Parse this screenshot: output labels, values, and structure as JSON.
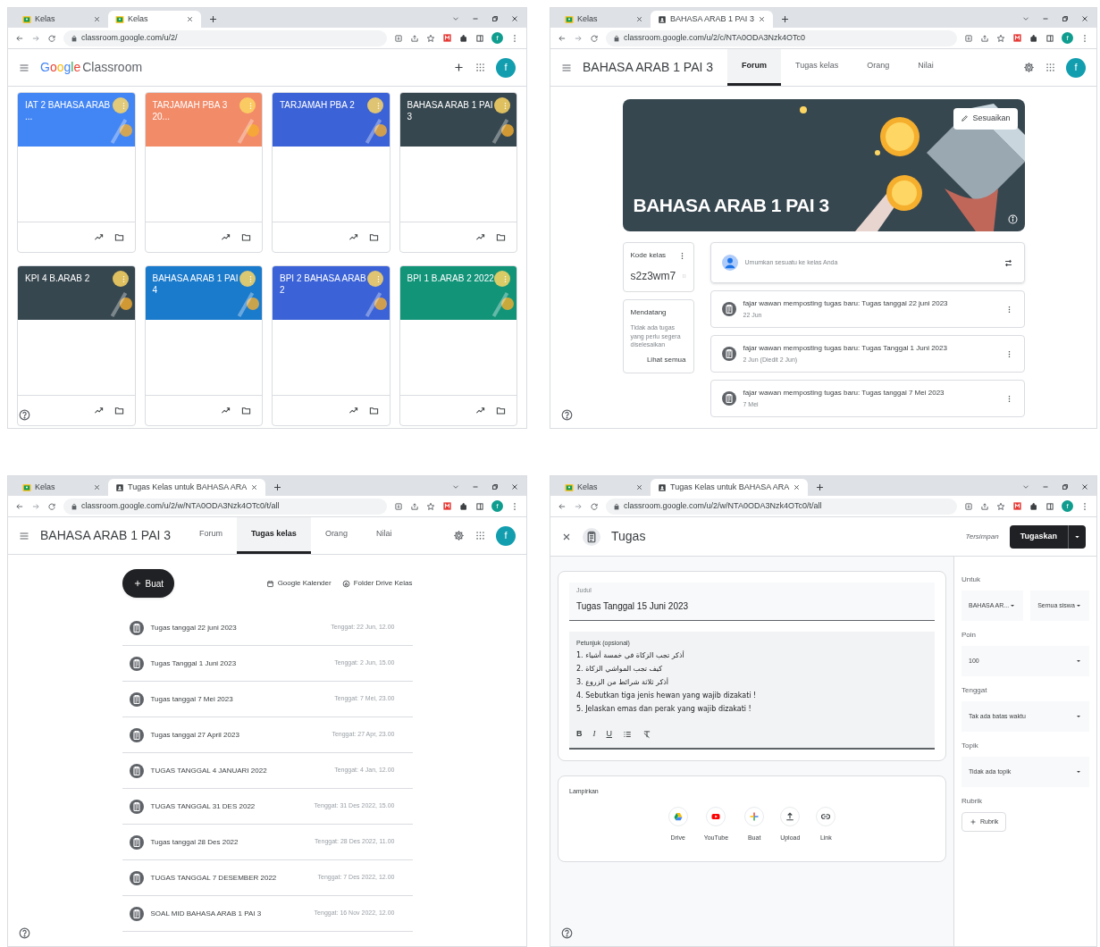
{
  "windows": [
    {
      "kind": "class_list",
      "tabs": [
        {
          "title": "Kelas",
          "kind": "classroom",
          "selected": false
        },
        {
          "title": "Kelas",
          "kind": "classroom",
          "selected": true
        }
      ],
      "url": "classroom.google.com/u/2/",
      "profile": "f",
      "logo_brand": "Google",
      "logo_product": "Classroom",
      "avatar": "f",
      "classes": [
        {
          "name": "IAT 2 BAHASA ARAB ...",
          "color": "#4285f4"
        },
        {
          "name": "TARJAMAH PBA 3 20...",
          "color": "#f28b68"
        },
        {
          "name": "TARJAMAH PBA 2",
          "color": "#3b62d6"
        },
        {
          "name": "BAHASA ARAB 1 PAI 3",
          "color": "#37474f"
        },
        {
          "name": "KPI 4 B.ARAB 2",
          "color": "#37474f"
        },
        {
          "name": "BAHASA ARAB 1 PAI 4",
          "color": "#1a7acc"
        },
        {
          "name": "BPI 2 BAHASA ARAB 2",
          "color": "#3b62d6"
        },
        {
          "name": "BPI 1 B.ARAB 2 2022",
          "color": "#129479"
        }
      ]
    },
    {
      "kind": "class_stream",
      "tabs": [
        {
          "title": "Kelas",
          "kind": "classroom",
          "selected": false
        },
        {
          "title": "BAHASA ARAB 1 PAI 3",
          "kind": "class",
          "selected": true
        }
      ],
      "url": "classroom.google.com/u/2/c/NTA0ODA3Nzk4OTc0",
      "profile": "f",
      "title": "BAHASA ARAB 1 PAI 3",
      "nav": [
        {
          "label": "Forum",
          "selected": true
        },
        {
          "label": "Tugas kelas",
          "selected": false
        },
        {
          "label": "Orang",
          "selected": false
        },
        {
          "label": "Nilai",
          "selected": false
        }
      ],
      "avatar": "f",
      "banner_title": "BAHASA ARAB 1 PAI 3",
      "customize": "Sesuaikan",
      "code_label": "Kode kelas",
      "code": "s2z3wm7",
      "upcoming_title": "Mendatang",
      "upcoming_text": "Tidak ada tugas yang perlu segera diselesaikan",
      "upcoming_link": "Lihat semua",
      "announce": "Umumkan sesuatu ke kelas Anda",
      "posts": [
        {
          "text": "fajar wawan memposting tugas baru: Tugas tanggal 22 juni 2023",
          "date": "22 Jun"
        },
        {
          "text": "fajar wawan memposting tugas baru: Tugas Tanggal 1 Juni 2023",
          "date": "2 Jun (Diedit 2 Jun)"
        },
        {
          "text": "fajar wawan memposting tugas baru: Tugas tanggal 7 Mei 2023",
          "date": "7 Mei"
        }
      ]
    },
    {
      "kind": "classwork",
      "tabs": [
        {
          "title": "Kelas",
          "kind": "classroom",
          "selected": false
        },
        {
          "title": "Tugas Kelas untuk BAHASA ARA",
          "kind": "class",
          "selected": true
        }
      ],
      "url": "classroom.google.com/u/2/w/NTA0ODA3Nzk4OTc0/t/all",
      "profile": "f",
      "title": "BAHASA ARAB 1 PAI 3",
      "nav": [
        {
          "label": "Forum",
          "selected": false
        },
        {
          "label": "Tugas kelas",
          "selected": true
        },
        {
          "label": "Orang",
          "selected": false
        },
        {
          "label": "Nilai",
          "selected": false
        }
      ],
      "avatar": "f",
      "create": "Buat",
      "calendar": "Google Kalender",
      "drive_folder": "Folder Drive Kelas",
      "assignments": [
        {
          "title": "Tugas tanggal 22 juni 2023",
          "due": "Tenggat: 22 Jun, 12.00"
        },
        {
          "title": "Tugas Tanggal 1 Juni 2023",
          "due": "Tenggat: 2 Jun, 15.00"
        },
        {
          "title": "Tugas tanggal 7 Mei 2023",
          "due": "Tenggat: 7 Mei, 23.00"
        },
        {
          "title": "Tugas tanggal 27 April 2023",
          "due": "Tenggat: 27 Apr, 23.00"
        },
        {
          "title": "TUGAS TANGGAL 4 JANUARI 2022",
          "due": "Tenggat: 4 Jan, 12.00"
        },
        {
          "title": "TUGAS TANGGAL 31 DES 2022",
          "due": "Tenggat: 31 Des 2022, 15.00"
        },
        {
          "title": "Tugas tanggal 28 Des 2022",
          "due": "Tenggat: 28 Des 2022, 11.00"
        },
        {
          "title": "TUGAS TANGGAL 7 DESEMBER 2022",
          "due": "Tenggat: 7 Des 2022, 12.00"
        },
        {
          "title": "SOAL MID BAHASA ARAB 1 PAI 3",
          "due": "Tenggat: 16 Nov 2022, 12.00"
        }
      ]
    },
    {
      "kind": "assignment_editor",
      "tabs": [
        {
          "title": "Kelas",
          "kind": "classroom",
          "selected": false
        },
        {
          "title": "Tugas Kelas untuk BAHASA ARA",
          "kind": "class",
          "selected": true
        }
      ],
      "url": "classroom.google.com/u/2/w/NTA0ODA3Nzk4OTc0/t/all",
      "profile": "f",
      "title": "Tugas",
      "saved": "Tersimpan",
      "assign": "Tugaskan",
      "title_label": "Judul",
      "title_value": "Tugas Tanggal 15 Juni 2023",
      "instructions_label": "Petunjuk (opsional)",
      "instructions": [
        "1. أذكر تجب الزكاة في خمسة أشياء",
        "2. كيف تجب المواشي الزكاة",
        "3. أذكر ثلاثة شرائط من الزروع",
        "4. Sebutkan tiga jenis hewan yang wajib dizakati !",
        "5. Jelaskan emas dan perak yang wajib dizakati !"
      ],
      "format": [
        {
          "kind": "bold",
          "label": "B"
        },
        {
          "kind": "italic",
          "label": "I"
        },
        {
          "kind": "underline",
          "label": "U"
        },
        {
          "kind": "list"
        },
        {
          "kind": "clear"
        }
      ],
      "attach_label": "Lampirkan",
      "attach": [
        {
          "kind": "drive",
          "label": "Drive"
        },
        {
          "kind": "youtube",
          "label": "YouTube"
        },
        {
          "kind": "create",
          "label": "Buat"
        },
        {
          "kind": "upload",
          "label": "Upload"
        },
        {
          "kind": "link",
          "label": "Link"
        }
      ],
      "settings": [
        {
          "label": "Untuk",
          "kind": "dropdowns",
          "values": [
            "BAHASA AR...",
            "Semua siswa"
          ]
        },
        {
          "label": "Poin",
          "kind": "dropdowns",
          "values": [
            "100"
          ]
        },
        {
          "label": "Tenggat",
          "kind": "dropdowns",
          "values": [
            "Tak ada batas waktu"
          ]
        },
        {
          "label": "Topik",
          "kind": "dropdowns",
          "values": [
            "Tidak ada topik"
          ]
        },
        {
          "label": "Rubrik",
          "kind": "button",
          "values": [
            "Rubrik"
          ]
        }
      ]
    }
  ]
}
